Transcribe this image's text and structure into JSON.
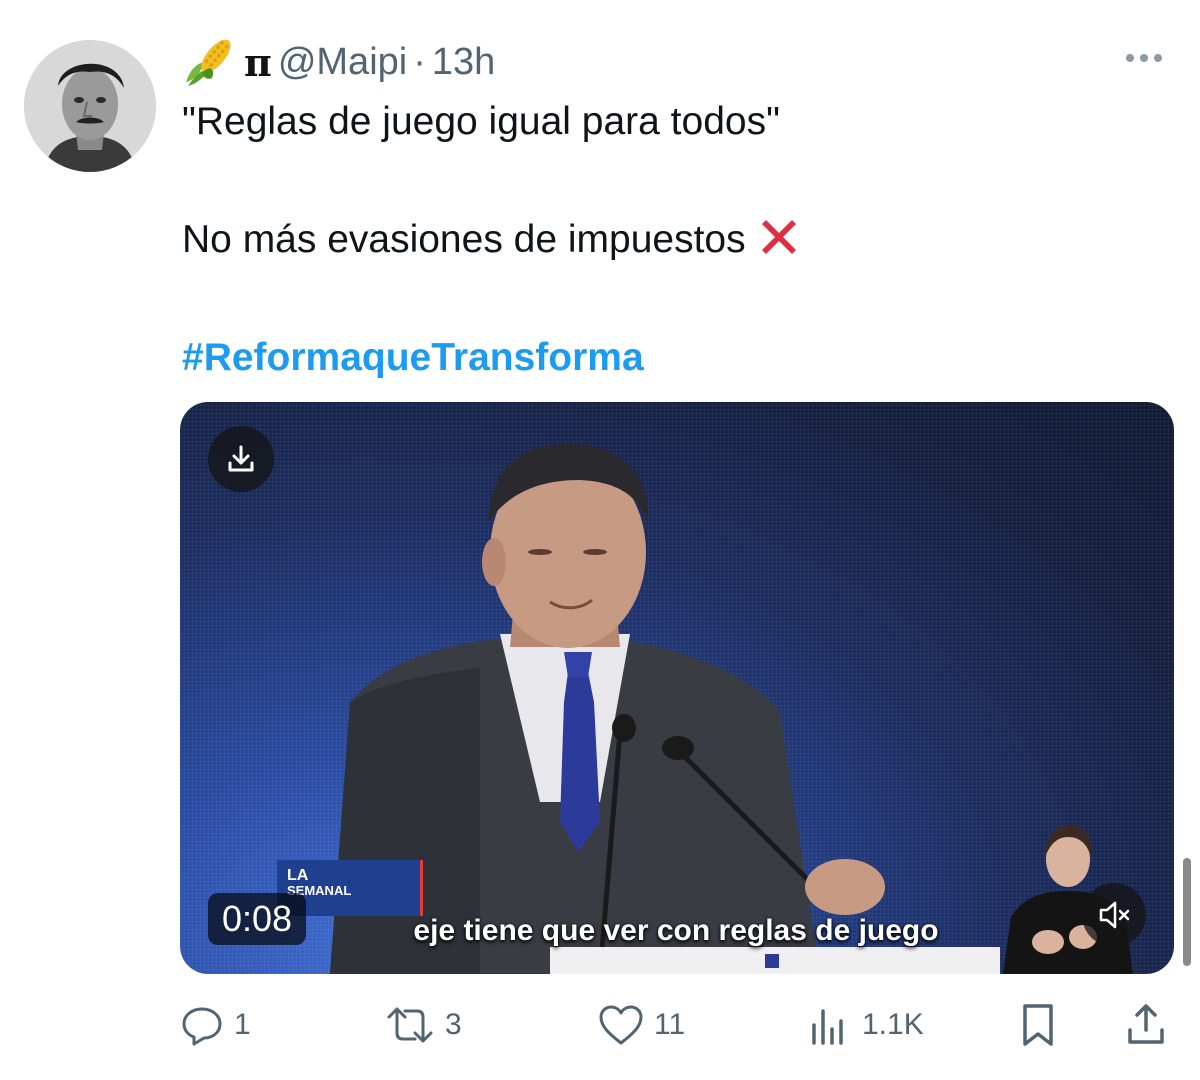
{
  "tweet": {
    "display_name_glyph": "π",
    "handle": "@Maipi",
    "separator": "·",
    "time": "13h",
    "text_line_1": "\"Reglas de juego igual para todos\"",
    "text_line_2": "No más evasiones de impuestos",
    "hashtag": "#ReformaqueTransforma"
  },
  "icons": {
    "name_emoji": "corn-icon",
    "text_emoji": "cross-mark-icon",
    "more": "more-icon",
    "download": "download-icon",
    "mute": "volume-muted-icon"
  },
  "video": {
    "duration": "0:08",
    "subtitle": "eje tiene que ver con reglas de juego",
    "logo_la": "LA",
    "logo_semanal": "SEMANAL"
  },
  "actions": {
    "replies": "1",
    "reposts": "3",
    "likes": "11",
    "views": "1.1K"
  },
  "colors": {
    "text": "#0f1419",
    "secondary": "#536471",
    "hashtag": "#1d9bf0",
    "cross_red": "#dd2e44"
  }
}
